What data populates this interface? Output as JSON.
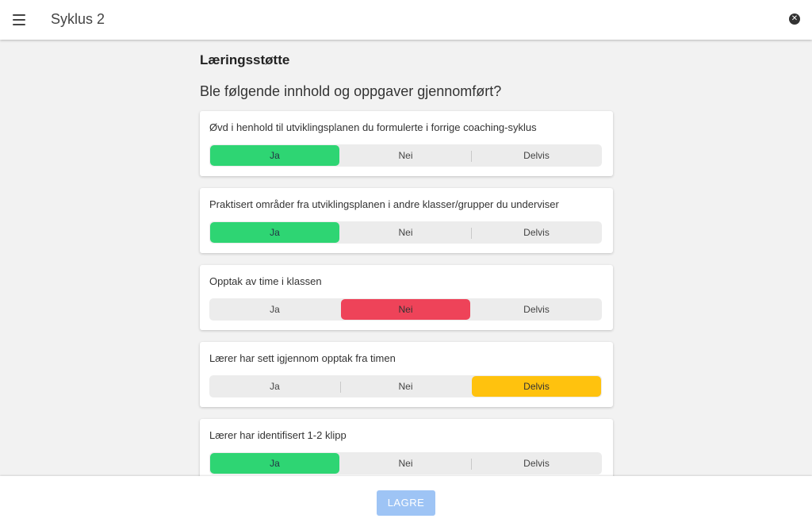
{
  "header": {
    "title": "Syklus 2",
    "menu_icon": "hamburger-menu-icon",
    "close_icon": "close-circle-icon"
  },
  "main": {
    "section_title": "Læringsstøtte",
    "question_heading": "Ble følgende innhold og oppgaver gjennomført?",
    "options": [
      "Ja",
      "Nei",
      "Delvis"
    ],
    "items": [
      {
        "label": "Øvd i henhold til utviklingsplanen du formulerte i forrige coaching-syklus",
        "selected": "Ja"
      },
      {
        "label": "Praktisert områder fra utviklingsplanen i andre klasser/grupper du underviser",
        "selected": "Ja"
      },
      {
        "label": "Opptak av time i klassen",
        "selected": "Nei"
      },
      {
        "label": "Lærer har sett igjennom opptak fra timen",
        "selected": "Delvis"
      },
      {
        "label": "Lærer har identifisert 1-2 klipp",
        "selected": "Ja"
      }
    ]
  },
  "colors": {
    "ja": "#2ed573",
    "nei": "#ee4359",
    "delvis": "#ffc20e",
    "save_button": "#9ec4f5"
  },
  "footer": {
    "save_label": "LAGRE"
  }
}
